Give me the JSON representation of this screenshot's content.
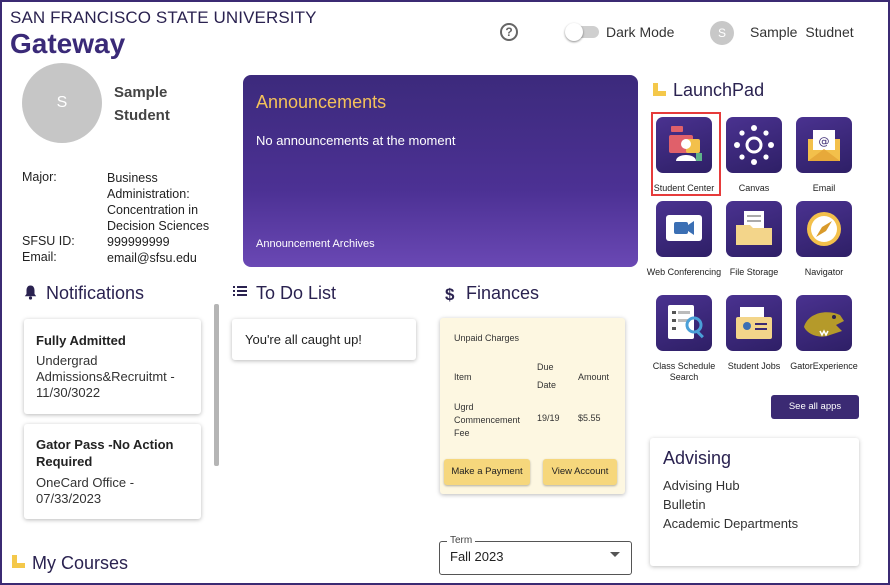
{
  "header": {
    "university": "SAN FRANCISCO STATE UNIVERSITY",
    "app_title": "Gateway",
    "help_symbol": "?",
    "dark_mode_label": "Dark Mode",
    "user_initial": "S",
    "user_name": "Sample  Studnet"
  },
  "profile": {
    "initial": "S",
    "name": "Sample Student",
    "major_label": "Major:",
    "major_value": "Business Administration: Concentration in Decision Sciences",
    "id_label": "SFSU ID:",
    "id_value": "999999999",
    "email_label": "Email:",
    "email_value": "email@sfsu.edu"
  },
  "announcements": {
    "title": "Announcements",
    "message": "No announcements at the moment",
    "archive_link": "Announcement Archives"
  },
  "notifications": {
    "title": "Notifications",
    "items": [
      {
        "title": "Fully Admitted",
        "body": "Undergrad Admissions&Recruitmt - 11/30/3022"
      },
      {
        "title": "Gator Pass -No Action Required",
        "body": "OneCard Office - 07/33/2023"
      }
    ]
  },
  "todo": {
    "title": "To Do List",
    "empty_message": "You're all caught up!"
  },
  "finances": {
    "title": "Finances",
    "card_title": "Unpaid Charges",
    "columns": [
      "Item",
      "Due Date",
      "Amount"
    ],
    "rows": [
      {
        "item": "Ugrd Commencement Fee",
        "due": "19/19",
        "amount": "$5.55"
      }
    ],
    "pay_button": "Make a Payment",
    "view_button": "View Account"
  },
  "courses": {
    "title": "My Courses",
    "term_label": "Term",
    "term_value": "Fall 2023"
  },
  "launchpad": {
    "title": "LaunchPad",
    "apps": [
      {
        "label": "Student Center",
        "icon": "student-center-icon"
      },
      {
        "label": "Canvas",
        "icon": "canvas-icon"
      },
      {
        "label": "Email",
        "icon": "email-icon"
      },
      {
        "label": "Web Conferencing",
        "icon": "web-conferencing-icon"
      },
      {
        "label": "File Storage",
        "icon": "file-storage-icon"
      },
      {
        "label": "Navigator",
        "icon": "navigator-icon"
      },
      {
        "label": "Class Schedule Search",
        "icon": "class-schedule-search-icon"
      },
      {
        "label": "Student Jobs",
        "icon": "student-jobs-icon"
      },
      {
        "label": "GatorExperience",
        "icon": "gator-experience-icon"
      }
    ],
    "see_all": "See all apps"
  },
  "advising": {
    "title": "Advising",
    "links": [
      "Advising Hub",
      "Bulletin",
      "Academic Departments"
    ]
  },
  "colors": {
    "brand_purple": "#3b2a73",
    "accent_gold": "#f4c84a",
    "finance_bg": "#fdf7e1",
    "highlight_red": "#e63b3b"
  }
}
